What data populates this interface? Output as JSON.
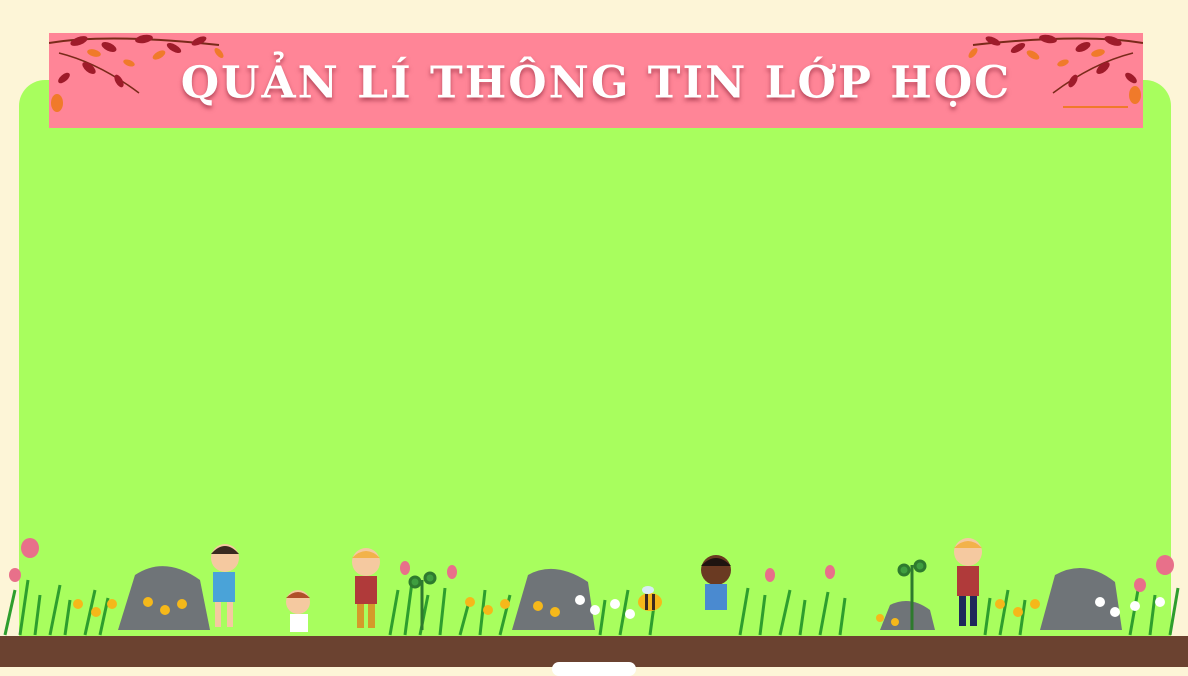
{
  "banner": {
    "title": "QUẢN LÍ THÔNG TIN LỚP HỌC"
  },
  "colors": {
    "background": "#fdf5d7",
    "board": "#a8fe5e",
    "banner": "#ff8597",
    "ground": "#6b4230",
    "leaf_dark": "#9e1b2a",
    "leaf_orange": "#f07a2a"
  },
  "decorations": {
    "icons": [
      "autumn-leaves-icon",
      "rock-icon",
      "tulip-icon",
      "daisy-icon",
      "grass-icon",
      "child-figure-icon",
      "bee-icon",
      "sapling-icon"
    ]
  }
}
